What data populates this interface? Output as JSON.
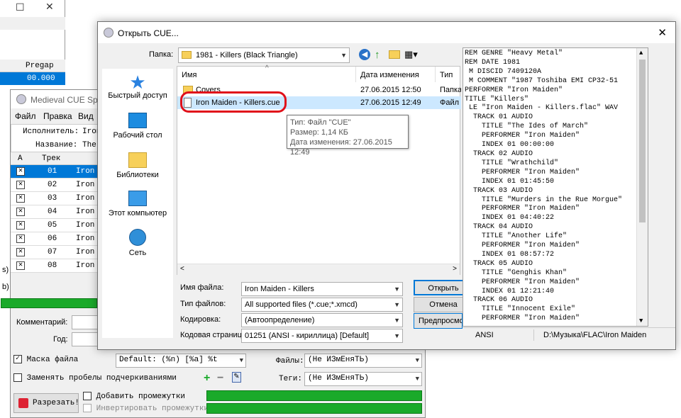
{
  "bg_window": {
    "col_pregap": "Pregap",
    "row_value": "00.000"
  },
  "cue_window": {
    "title": "Medieval CUE Splitter",
    "menu": [
      "Файл",
      "Правка",
      "Вид"
    ],
    "performer_label": "Исполнитель:",
    "performer_value": "Iron",
    "title_label": "Название:",
    "title_value": "The",
    "col_a": "A",
    "col_track": "Трек",
    "tracks": [
      {
        "num": "01",
        "name": "Iron"
      },
      {
        "num": "02",
        "name": "Iron"
      },
      {
        "num": "03",
        "name": "Iron"
      },
      {
        "num": "04",
        "name": "Iron"
      },
      {
        "num": "05",
        "name": "Iron"
      },
      {
        "num": "06",
        "name": "Iron"
      },
      {
        "num": "07",
        "name": "Iron"
      },
      {
        "num": "08",
        "name": "Iron"
      }
    ],
    "side_a": "s)",
    "side_b": "b)",
    "comment_label": "Комментарий:",
    "year_label": "Год:",
    "mask_label": "Маска файла",
    "mask_value": "Default: (%n) [%a] %t",
    "replace_label": "Заменять пробелы подчеркиваниями",
    "files_label": "Файлы:",
    "files_value": "(Не ИЗмЕняТЬ)",
    "tags_label": "Теги:",
    "tags_value": "(Не ИЗмЕняТЬ)",
    "split_button": "Разрезать!",
    "add_gaps": "Добавить промежутки",
    "invert_gaps": "Инвертировать промежутки"
  },
  "dialog": {
    "title": "Открыть CUE...",
    "folder_label": "Папка:",
    "folder_value": "1981 - Killers (Black Triangle)",
    "places": [
      "Быстрый доступ",
      "Рабочий стол",
      "Библиотеки",
      "Этот компьютер",
      "Сеть"
    ],
    "columns": {
      "name": "Имя",
      "date": "Дата изменения",
      "type": "Тип"
    },
    "files": [
      {
        "name": "Covers",
        "date": "27.06.2015 12:50",
        "type": "Папка с ф"
      },
      {
        "name": "Iron Maiden - Killers.cue",
        "date": "27.06.2015 12:49",
        "type": "Файл \"CU"
      }
    ],
    "tooltip": [
      "Тип: Файл \"CUE\"",
      "Размер: 1,14 КБ",
      "Дата изменения: 27.06.2015 12:49"
    ],
    "filename_label": "Имя файла:",
    "filename_value": "Iron Maiden - Killers",
    "filetype_label": "Тип файлов:",
    "filetype_value": "All supported files (*.cue;*.xmcd)",
    "encoding_label": "Кодировка:",
    "encoding_value": "(Автоопределение)",
    "codepage_label": "Кодовая страница",
    "codepage_value": "01251 (ANSI - кириллица) [Default]",
    "open_button": "Открыть",
    "cancel_button": "Отмена",
    "preview_button": "Предпросмотр",
    "preview_lines": [
      "REM GENRE \"Heavy Metal\"",
      "REM DATE 1981",
      " M DISCID 7409120A",
      " M COMMENT \"1987 Toshiba EMI CP32-51",
      "PERFORMER \"Iron Maiden\"",
      "TITLE \"Killers\"",
      " LE \"Iron Maiden - Killers.flac\" WAV",
      "  TRACK 01 AUDIO",
      "    TITLE \"The Ides of March\"",
      "    PERFORMER \"Iron Maiden\"",
      "    INDEX 01 00:00:00",
      "  TRACK 02 AUDIO",
      "    TITLE \"Wrathchild\"",
      "    PERFORMER \"Iron Maiden\"",
      "    INDEX 01 01:45:50",
      "  TRACK 03 AUDIO",
      "    TITLE \"Murders in the Rue Morgue\"",
      "    PERFORMER \"Iron Maiden\"",
      "    INDEX 01 04:40:22",
      "  TRACK 04 AUDIO",
      "    TITLE \"Another Life\"",
      "    PERFORMER \"Iron Maiden\"",
      "    INDEX 01 08:57:72",
      "  TRACK 05 AUDIO",
      "    TITLE \"Genghis Khan\"",
      "    PERFORMER \"Iron Maiden\"",
      "    INDEX 01 12:21:40",
      "  TRACK 06 AUDIO",
      "    TITLE \"Innocent Exile\"",
      "    PERFORMER \"Iron Maiden\""
    ],
    "status_encoding": "ANSI",
    "status_path": "D:\\Музыка\\FLAC\\Iron Maiden"
  },
  "colors": {
    "selection": "#0078d7",
    "highlight_ring": "#e0101a",
    "progress": "#1aaa2a"
  }
}
